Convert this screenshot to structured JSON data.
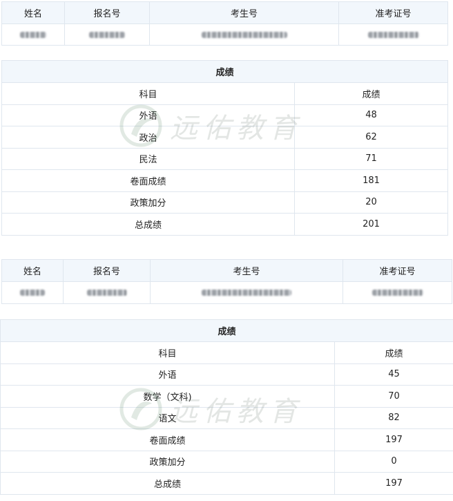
{
  "blocks": [
    {
      "headers": [
        "姓名",
        "报名号",
        "考生号",
        "准考证号"
      ],
      "score_title": "成绩",
      "subject_col": "科目",
      "score_col": "成绩",
      "rows": [
        {
          "subject": "外语",
          "score": "48"
        },
        {
          "subject": "政治",
          "score": "62"
        },
        {
          "subject": "民法",
          "score": "71"
        },
        {
          "subject": "卷面成绩",
          "score": "181"
        },
        {
          "subject": "政策加分",
          "score": "20"
        },
        {
          "subject": "总成绩",
          "score": "201"
        }
      ]
    },
    {
      "headers": [
        "姓名",
        "报名号",
        "考生号",
        "准考证号"
      ],
      "score_title": "成绩",
      "subject_col": "科目",
      "score_col": "成绩",
      "rows": [
        {
          "subject": "外语",
          "score": "45"
        },
        {
          "subject": "数学（文科)",
          "score": "70"
        },
        {
          "subject": "语文",
          "score": "82"
        },
        {
          "subject": "卷面成绩",
          "score": "197"
        },
        {
          "subject": "政策加分",
          "score": "0"
        },
        {
          "subject": "总成绩",
          "score": "197"
        }
      ]
    }
  ],
  "watermark": "远佑教育"
}
